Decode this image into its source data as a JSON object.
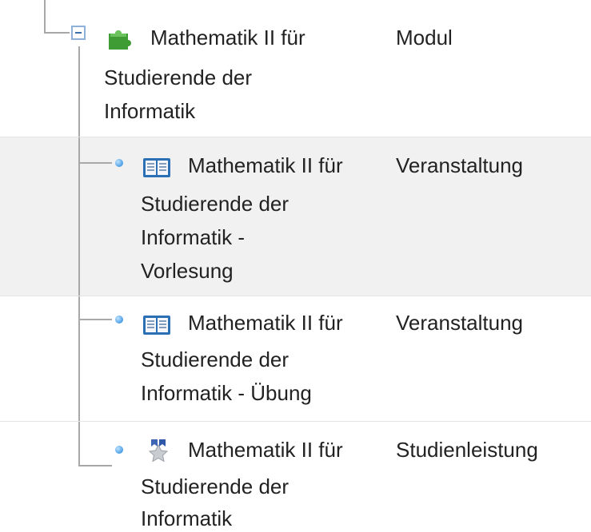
{
  "tree": {
    "module": {
      "title_lines": [
        "Mathematik II für",
        "Studierende der",
        "Informatik"
      ],
      "type": "Modul",
      "icon": "puzzle-piece-icon"
    },
    "children": [
      {
        "title_lines": [
          "Mathematik II für",
          "Studierende der",
          "Informatik -",
          "Vorlesung"
        ],
        "type": "Veranstaltung",
        "icon": "open-book-icon",
        "highlighted": true
      },
      {
        "title_lines": [
          "Mathematik II für",
          "Studierende der",
          "Informatik - Übung"
        ],
        "type": "Veranstaltung",
        "icon": "open-book-icon",
        "highlighted": false
      },
      {
        "title_lines": [
          "Mathematik II für",
          "Studierende der",
          "Informatik"
        ],
        "type": "Studienleistung",
        "icon": "star-ribbon-icon",
        "highlighted": false
      }
    ]
  },
  "colors": {
    "tree_line": "#a8a8a8",
    "highlight_row": "#f1f1f1",
    "toggle_border": "#8fb0d8",
    "bullet": "#4a9ee6"
  }
}
